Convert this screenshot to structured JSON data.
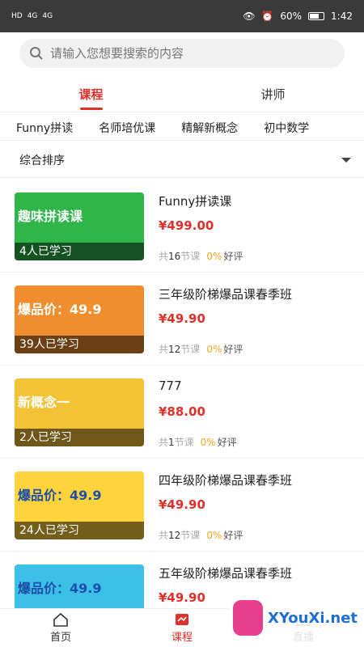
{
  "statusbar": {
    "left_signals": [
      "HD",
      "4G",
      "4G"
    ],
    "battery": "60%",
    "time": "1:42"
  },
  "search": {
    "placeholder": "请输入您想要搜索的内容"
  },
  "tabs": [
    {
      "label": "课程",
      "active": true
    },
    {
      "label": "讲师",
      "active": false
    }
  ],
  "categories": [
    "Funny拼读",
    "名师培优课",
    "精解新概念",
    "初中数学"
  ],
  "sort": {
    "label": "综合排序"
  },
  "courses": [
    {
      "title": "Funny拼读课",
      "price": "¥499.00",
      "learners": "4人已学习",
      "lessons_prefix": "共",
      "lessons": "16",
      "lessons_suffix": "节课",
      "rating": "0%",
      "rating_label": "好评",
      "thumb_text": "趣味拼读课"
    },
    {
      "title": "三年级阶梯爆品课春季班",
      "price": "¥49.90",
      "learners": "39人已学习",
      "lessons_prefix": "共",
      "lessons": "12",
      "lessons_suffix": "节课",
      "rating": "0%",
      "rating_label": "好评",
      "thumb_text": "爆品价：49.9"
    },
    {
      "title": "777",
      "price": "¥88.00",
      "learners": "2人已学习",
      "lessons_prefix": "共",
      "lessons": "1",
      "lessons_suffix": "节课",
      "rating": "0%",
      "rating_label": "好评",
      "thumb_text": "新概念一"
    },
    {
      "title": "四年级阶梯爆品课春季班",
      "price": "¥49.90",
      "learners": "24人已学习",
      "lessons_prefix": "共",
      "lessons": "12",
      "lessons_suffix": "节课",
      "rating": "0%",
      "rating_label": "好评",
      "thumb_text": "爆品价：49.9"
    },
    {
      "title": "五年级阶梯爆品课春季班",
      "price": "¥49.90",
      "learners": "",
      "lessons_prefix": "",
      "lessons": "",
      "lessons_suffix": "",
      "rating": "",
      "rating_label": "",
      "thumb_text": "爆品价：49.9"
    }
  ],
  "bottom_nav": [
    {
      "label": "首页",
      "icon": "home-icon",
      "active": false
    },
    {
      "label": "课程",
      "icon": "course-icon",
      "active": true
    },
    {
      "label": "直播",
      "icon": "live-icon",
      "active": false
    }
  ],
  "watermark": {
    "text": "XYouXi.net"
  },
  "colors": {
    "accent": "#e0302a",
    "orange": "#f5a623"
  }
}
